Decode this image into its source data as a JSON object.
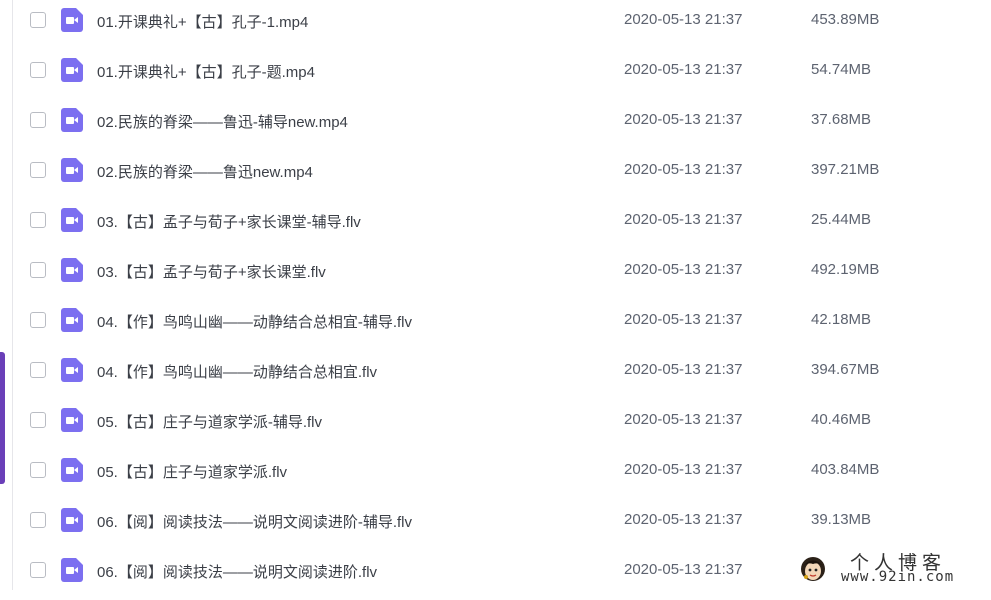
{
  "files": [
    {
      "name": "01.开课典礼+【古】孔子-1.mp4",
      "modified": "2020-05-13 21:37",
      "size": "453.89MB",
      "icon": "video-file-icon"
    },
    {
      "name": "01.开课典礼+【古】孔子-题.mp4",
      "modified": "2020-05-13 21:37",
      "size": "54.74MB",
      "icon": "video-file-icon"
    },
    {
      "name": "02.民族的脊梁——鲁迅-辅导new.mp4",
      "modified": "2020-05-13 21:37",
      "size": "37.68MB",
      "icon": "video-file-icon"
    },
    {
      "name": "02.民族的脊梁——鲁迅new.mp4",
      "modified": "2020-05-13 21:37",
      "size": "397.21MB",
      "icon": "video-file-icon"
    },
    {
      "name": "03.【古】孟子与荀子+家长课堂-辅导.flv",
      "modified": "2020-05-13 21:37",
      "size": "25.44MB",
      "icon": "video-file-icon"
    },
    {
      "name": "03.【古】孟子与荀子+家长课堂.flv",
      "modified": "2020-05-13 21:37",
      "size": "492.19MB",
      "icon": "video-file-icon"
    },
    {
      "name": "04.【作】鸟鸣山幽——动静结合总相宜-辅导.flv",
      "modified": "2020-05-13 21:37",
      "size": "42.18MB",
      "icon": "video-file-icon"
    },
    {
      "name": "04.【作】鸟鸣山幽——动静结合总相宜.flv",
      "modified": "2020-05-13 21:37",
      "size": "394.67MB",
      "icon": "video-file-icon"
    },
    {
      "name": "05.【古】庄子与道家学派-辅导.flv",
      "modified": "2020-05-13 21:37",
      "size": "40.46MB",
      "icon": "video-file-icon"
    },
    {
      "name": "05.【古】庄子与道家学派.flv",
      "modified": "2020-05-13 21:37",
      "size": "403.84MB",
      "icon": "video-file-icon"
    },
    {
      "name": "06.【阅】阅读技法——说明文阅读进阶-辅导.flv",
      "modified": "2020-05-13 21:37",
      "size": "39.13MB",
      "icon": "video-file-icon"
    },
    {
      "name": "06.【阅】阅读技法——说明文阅读进阶.flv",
      "modified": "2020-05-13 21:37",
      "size": "",
      "icon": "video-file-icon"
    }
  ],
  "watermark": {
    "title": "个人博客",
    "url": "www.92in.com"
  },
  "colors": {
    "icon": "#7c6ff0",
    "accent": "#6a3fb8",
    "text": "#3b3f47",
    "meta_text": "#5d6370"
  }
}
